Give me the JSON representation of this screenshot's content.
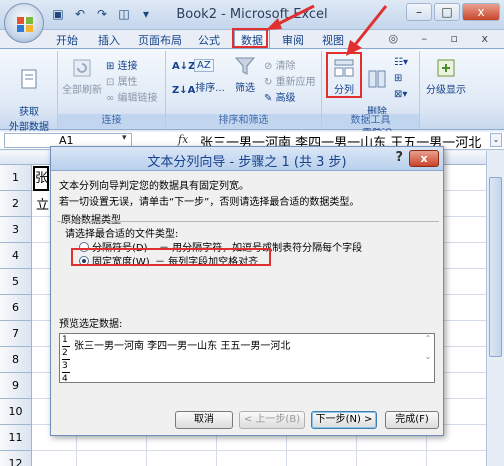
{
  "window": {
    "title": "Book2 - Microsoft Excel",
    "controls": {
      "minimize": "–",
      "maximize": "□",
      "close": "x"
    }
  },
  "ribbon_tabs": [
    "开始",
    "插入",
    "页面布局",
    "公式",
    "数据",
    "审阅",
    "视图"
  ],
  "active_tab": "数据",
  "ribbon_right_icons": "◎ – ▫ x",
  "ribbon": {
    "get_external": "获取\n外部数据",
    "refresh_all": "全部刷新",
    "connections": "连接",
    "properties": "属性",
    "edit_links": "编辑链接",
    "group_connections": "连接",
    "sort": "排序...",
    "filter": "筛选",
    "clear": "清除",
    "reapply": "重新应用",
    "advanced": "高级",
    "group_sort_filter": "排序和筛选",
    "text_to_columns": "分列",
    "remove_duplicates": "删除\n重复项",
    "group_data_tools": "数据工具",
    "outline": "分级显示"
  },
  "formula_bar": {
    "cell_ref": "A1",
    "fx": "fx",
    "content": "张三一男一河南 李四一男一山东 王五一男一河北"
  },
  "sheet": {
    "row_numbers": [
      "1",
      "2",
      "3",
      "4",
      "5",
      "6",
      "7",
      "8",
      "9",
      "10",
      "11",
      "12"
    ],
    "cell_a1": "张",
    "cell_a2": "立"
  },
  "dialog": {
    "title": "文本分列向导 - 步骤之 1 (共 3 步)",
    "help": "?",
    "close": "x",
    "intro1": "文本分列向导判定您的数据具有固定列宽。",
    "intro2": "若一切设置无误，请单击“下一步”，否则请选择最合适的数据类型。",
    "section_label": "原始数据类型",
    "choose_label": "请选择最合适的文件类型:",
    "option_delimited": "分隔符号(D)",
    "option_delimited_desc": "－ 用分隔字符，如逗号或制表符分隔每个字段",
    "option_fixed": "固定宽度(W)",
    "option_fixed_desc": "－ 每列字段加空格对齐",
    "preview_label": "预览选定数据:",
    "preview_rows": [
      "张三一男一河南 李四一男一山东 王五一男一河北",
      "",
      "",
      ""
    ],
    "preview_line_numbers": [
      "1",
      "2",
      "3",
      "4"
    ],
    "buttons": {
      "cancel": "取消",
      "back": "< 上一步(B)",
      "next": "下一步(N) >",
      "finish": "完成(F)"
    }
  },
  "colors": {
    "highlight_red": "#e03030",
    "ribbon_blue": "#15428b"
  }
}
